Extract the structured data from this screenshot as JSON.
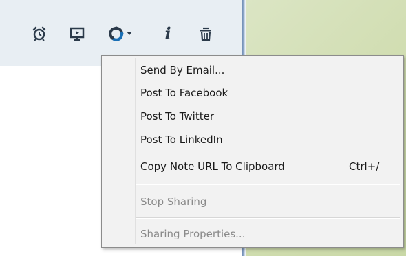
{
  "toolbar": {
    "icons": [
      {
        "name": "alarm-clock-icon"
      },
      {
        "name": "presentation-icon"
      },
      {
        "name": "share-icon"
      },
      {
        "name": "info-icon",
        "text": "i"
      },
      {
        "name": "trash-icon"
      }
    ]
  },
  "share_menu": {
    "items": [
      {
        "label": "Send By Email...",
        "enabled": true
      },
      {
        "label": "Post To Facebook",
        "enabled": true
      },
      {
        "label": "Post To Twitter",
        "enabled": true
      },
      {
        "label": "Post To LinkedIn",
        "enabled": true
      },
      {
        "label": "Copy Note URL To Clipboard",
        "shortcut": "Ctrl+/",
        "enabled": true
      },
      {
        "label": "Stop Sharing",
        "enabled": false
      },
      {
        "label": "Sharing Properties...",
        "enabled": false
      }
    ]
  },
  "colors": {
    "toolbar_bg": "#e8eef3",
    "menu_bg": "#f2f2f2",
    "disabled_text": "#8a8a8a",
    "accent": "#1a6fb5"
  }
}
